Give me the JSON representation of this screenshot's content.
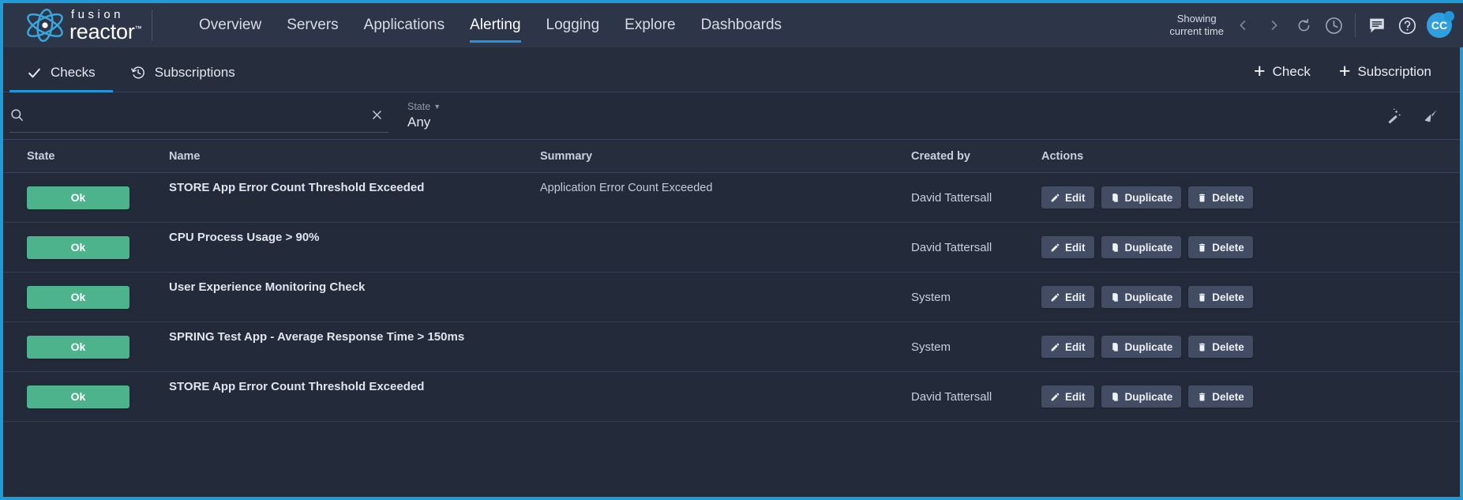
{
  "brand": {
    "fusion": "fusion",
    "reactor": "reactor",
    "tm": "™"
  },
  "nav": {
    "items": [
      {
        "label": "Overview",
        "active": false
      },
      {
        "label": "Servers",
        "active": false
      },
      {
        "label": "Applications",
        "active": false
      },
      {
        "label": "Alerting",
        "active": true
      },
      {
        "label": "Logging",
        "active": false
      },
      {
        "label": "Explore",
        "active": false
      },
      {
        "label": "Dashboards",
        "active": false
      }
    ]
  },
  "header_right": {
    "showing_line1": "Showing",
    "showing_line2": "current time",
    "prev_icon": "chevron-left-icon",
    "next_icon": "chevron-right-icon",
    "refresh_icon": "refresh-icon",
    "clock_icon": "clock-icon",
    "chat_icon": "chat-icon",
    "help_icon": "help-icon",
    "avatar_initials": "CC",
    "avatar_color": "#2f9fe0"
  },
  "tabs": [
    {
      "label": "Checks",
      "icon": "check-icon",
      "active": true
    },
    {
      "label": "Subscriptions",
      "icon": "history-icon",
      "active": false
    }
  ],
  "tab_actions": [
    {
      "label": "Check",
      "icon": "plus-icon"
    },
    {
      "label": "Subscription",
      "icon": "plus-icon"
    }
  ],
  "filter": {
    "search_value": "",
    "search_placeholder": "",
    "search_icon": "search-icon",
    "clear_icon": "close-icon",
    "state_label": "State",
    "state_value": "Any",
    "wand_icon": "magic-wand-icon",
    "broom_icon": "broom-icon"
  },
  "table": {
    "headers": {
      "state": "State",
      "name": "Name",
      "summary": "Summary",
      "created_by": "Created by",
      "actions": "Actions"
    },
    "action_labels": {
      "edit": "Edit",
      "duplicate": "Duplicate",
      "delete": "Delete"
    },
    "ok_color": "#4cb38c",
    "rows": [
      {
        "state": "Ok",
        "name": "STORE App Error Count Threshold Exceeded",
        "summary": "Application Error Count Exceeded",
        "created_by": "David Tattersall"
      },
      {
        "state": "Ok",
        "name": "CPU Process Usage > 90%",
        "summary": "",
        "created_by": "David Tattersall"
      },
      {
        "state": "Ok",
        "name": "User Experience Monitoring Check",
        "summary": "",
        "created_by": "System"
      },
      {
        "state": "Ok",
        "name": "SPRING Test App - Average Response Time > 150ms",
        "summary": "",
        "created_by": "System"
      },
      {
        "state": "Ok",
        "name": "STORE App Error Count Threshold Exceeded",
        "summary": "",
        "created_by": "David Tattersall"
      }
    ]
  }
}
